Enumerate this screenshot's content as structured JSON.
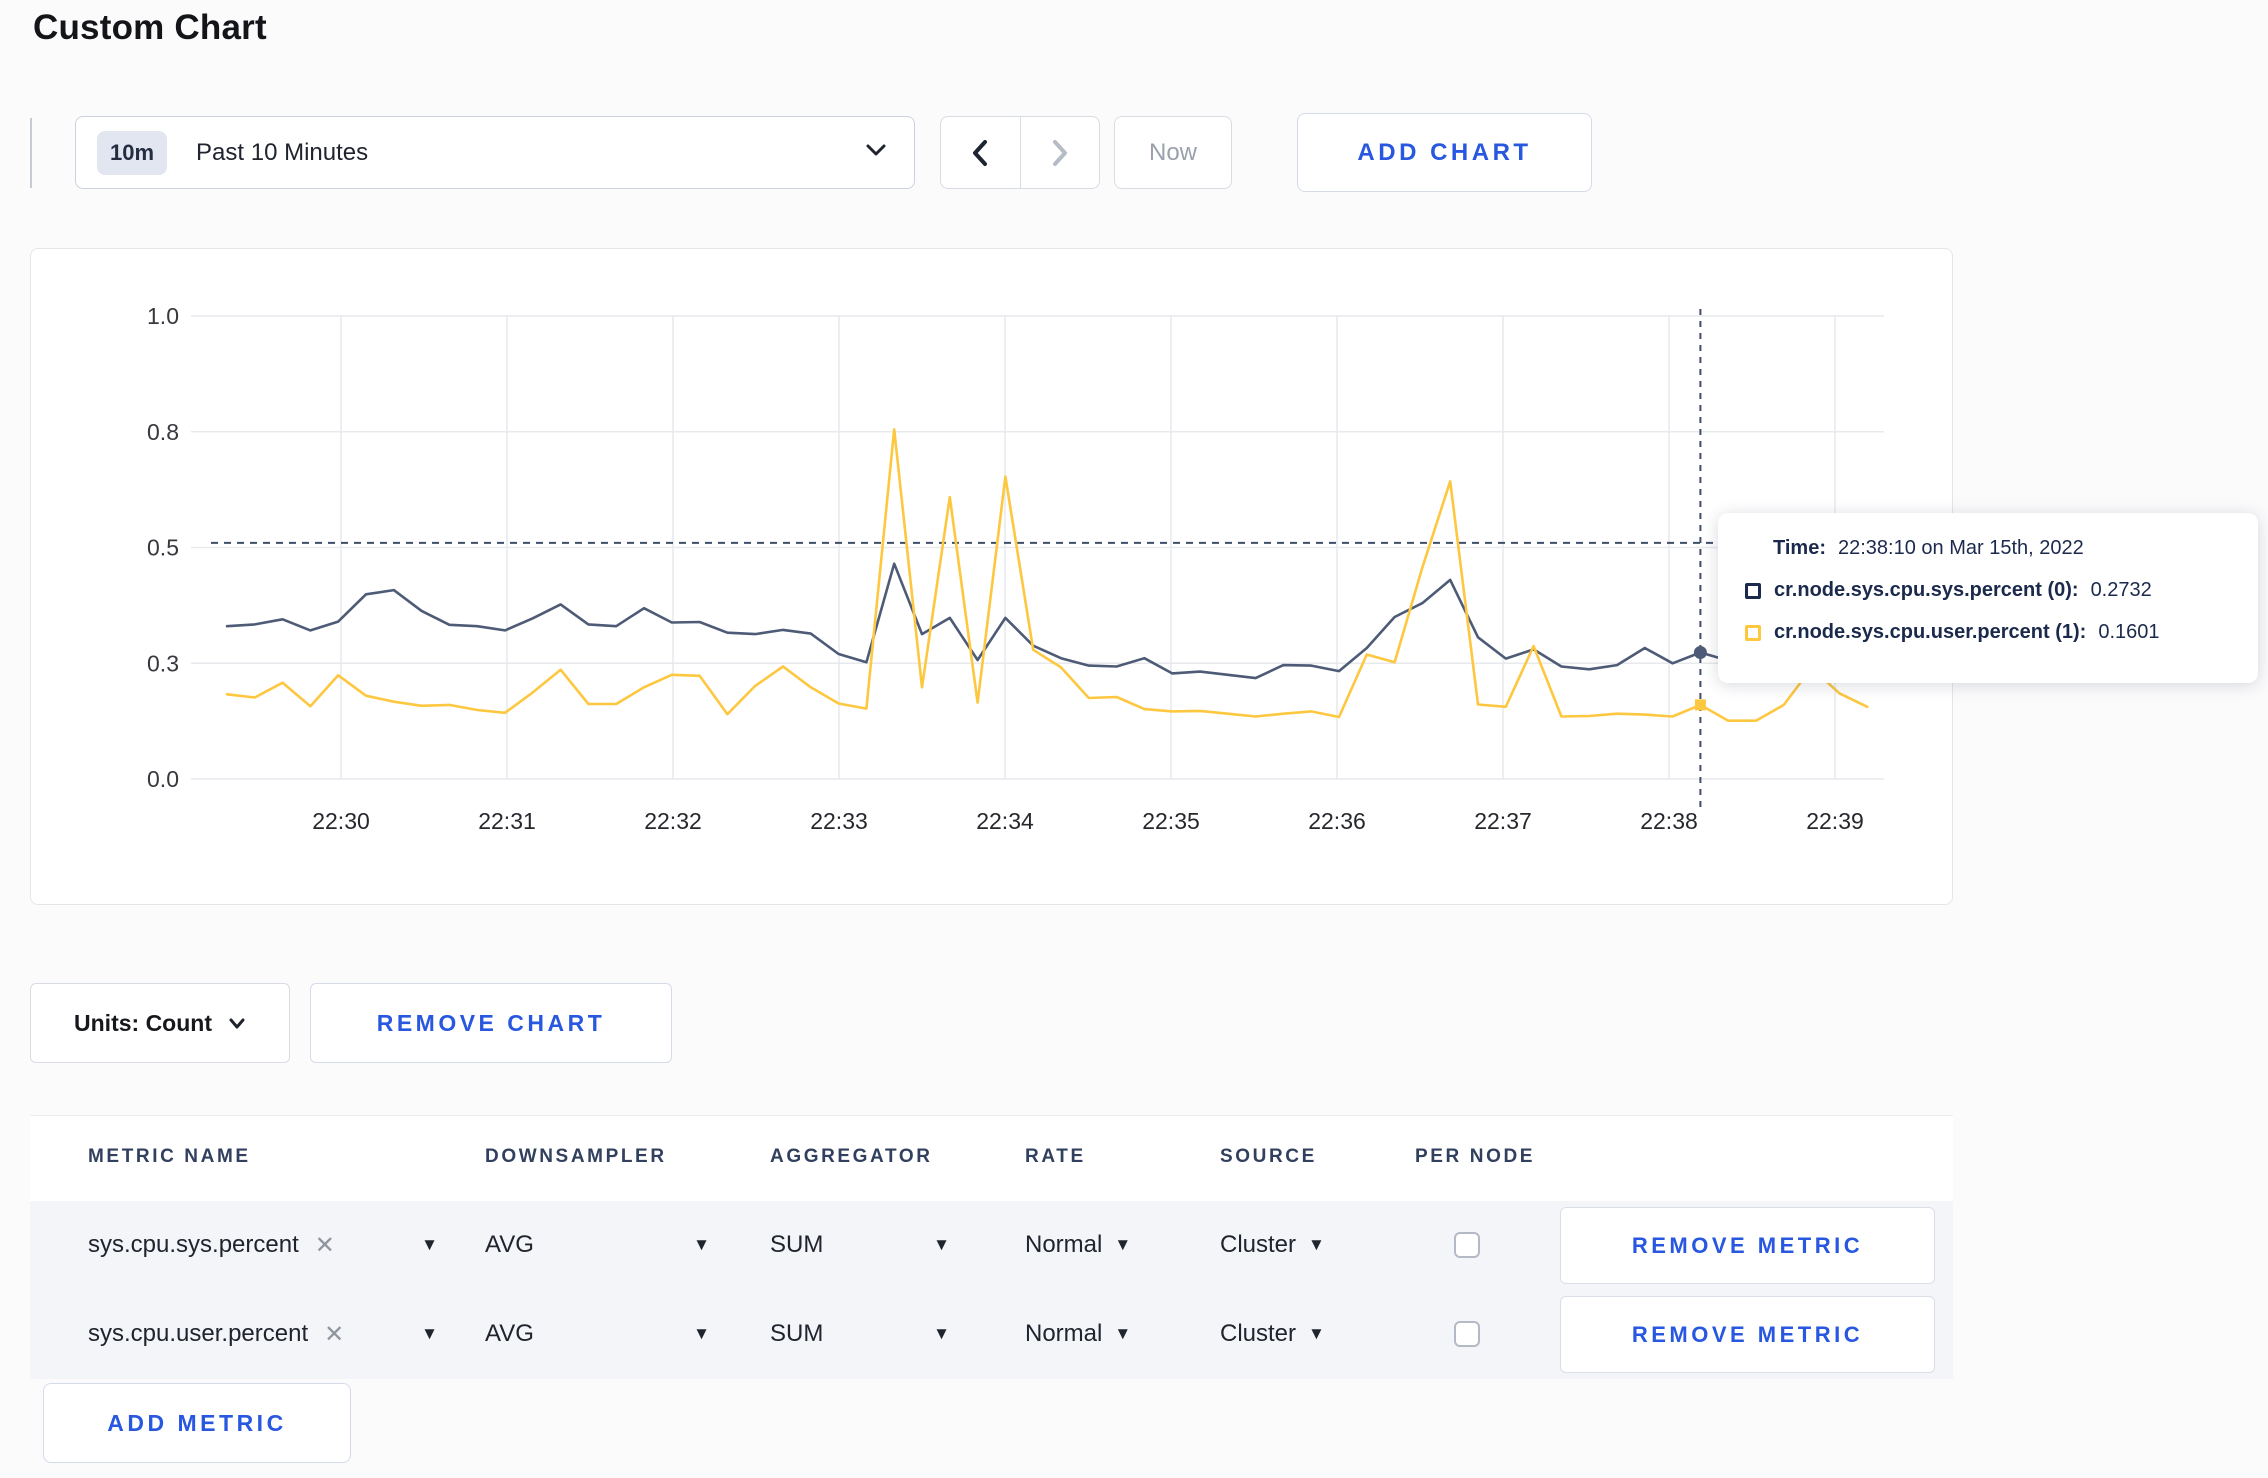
{
  "page": {
    "title": "Custom Chart"
  },
  "toolbar": {
    "range_badge": "10m",
    "range_label": "Past 10 Minutes",
    "now_label": "Now",
    "add_chart_label": "ADD CHART"
  },
  "tooltip": {
    "time_label": "Time:",
    "time_value": "22:38:10 on Mar 15th, 2022",
    "rows": [
      {
        "label": "cr.node.sys.cpu.sys.percent (0):",
        "value": "0.2732",
        "color": "#1b2a4c"
      },
      {
        "label": "cr.node.sys.cpu.user.percent (1):",
        "value": "0.1601",
        "color": "#fdc73f"
      }
    ]
  },
  "units": {
    "label": "Units: Count"
  },
  "remove_chart_label": "REMOVE CHART",
  "add_metric_label": "ADD METRIC",
  "table": {
    "headers": [
      "METRIC NAME",
      "DOWNSAMPLER",
      "AGGREGATOR",
      "RATE",
      "SOURCE",
      "PER NODE"
    ],
    "remove_metric_label": "REMOVE METRIC",
    "rows": [
      {
        "metric": "sys.cpu.sys.percent",
        "downsampler": "AVG",
        "aggregator": "SUM",
        "rate": "Normal",
        "source": "Cluster",
        "per_node_checked": false
      },
      {
        "metric": "sys.cpu.user.percent",
        "downsampler": "AVG",
        "aggregator": "SUM",
        "rate": "Normal",
        "source": "Cluster",
        "per_node_checked": false
      }
    ]
  },
  "chart_data": {
    "type": "line",
    "title": "",
    "xlabel": "",
    "ylabel": "",
    "x_start": "22:29:20",
    "x_step_seconds": 10,
    "x_ticks": [
      "22:30",
      "22:31",
      "22:32",
      "22:33",
      "22:34",
      "22:35",
      "22:36",
      "22:37",
      "22:38",
      "22:39"
    ],
    "ylim": [
      0,
      1
    ],
    "y_tick_values": [
      0,
      0.25,
      0.5,
      0.75,
      1.0
    ],
    "y_tick_labels": [
      "0.0",
      "0.3",
      "0.5",
      "0.8",
      "1.0"
    ],
    "grid": true,
    "legend_position": "tooltip",
    "series": [
      {
        "name": "cr.node.sys.cpu.sys.percent",
        "color": "#4e5b76",
        "values": [
          0.33,
          0.334,
          0.345,
          0.321,
          0.34,
          0.399,
          0.408,
          0.363,
          0.333,
          0.33,
          0.321,
          0.347,
          0.377,
          0.334,
          0.33,
          0.369,
          0.338,
          0.339,
          0.316,
          0.313,
          0.322,
          0.314,
          0.27,
          0.252,
          0.465,
          0.313,
          0.348,
          0.257,
          0.348,
          0.288,
          0.261,
          0.245,
          0.243,
          0.261,
          0.228,
          0.232,
          0.225,
          0.218,
          0.246,
          0.245,
          0.233,
          0.283,
          0.35,
          0.38,
          0.43,
          0.306,
          0.26,
          0.28,
          0.243,
          0.237,
          0.246,
          0.283,
          0.25,
          0.2732,
          0.256,
          0.298,
          0.294,
          0.308,
          0.3,
          0.262
        ]
      },
      {
        "name": "cr.node.sys.cpu.user.percent",
        "color": "#fdc73f",
        "values": [
          0.183,
          0.176,
          0.208,
          0.157,
          0.224,
          0.18,
          0.167,
          0.158,
          0.16,
          0.149,
          0.143,
          0.187,
          0.236,
          0.162,
          0.162,
          0.198,
          0.225,
          0.223,
          0.14,
          0.201,
          0.243,
          0.198,
          0.163,
          0.152,
          0.755,
          0.198,
          0.609,
          0.165,
          0.653,
          0.279,
          0.241,
          0.175,
          0.177,
          0.151,
          0.146,
          0.147,
          0.141,
          0.135,
          0.141,
          0.146,
          0.134,
          0.269,
          0.252,
          0.457,
          0.643,
          0.161,
          0.156,
          0.287,
          0.135,
          0.136,
          0.141,
          0.139,
          0.135,
          0.1601,
          0.126,
          0.126,
          0.16,
          0.24,
          0.185,
          0.156
        ]
      }
    ],
    "crosshair": {
      "time": "22:38:10",
      "index": 53,
      "hline_value": 0.51,
      "sys_value": 0.2732,
      "user_value": 0.1601,
      "color": "#3f4e68"
    },
    "gridline_color": "#e7e9ed"
  }
}
